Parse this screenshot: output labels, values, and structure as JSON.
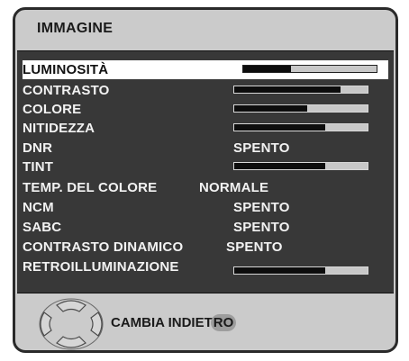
{
  "title": "IMMAGINE",
  "items": [
    {
      "label": "LUMINOSITÀ",
      "level": 0.36,
      "selected": true
    },
    {
      "label": "CONTRASTO",
      "level": 0.8
    },
    {
      "label": "COLORE",
      "level": 0.55
    },
    {
      "label": "NITIDEZZA",
      "level": 0.68
    },
    {
      "label": "DNR",
      "value": "SPENTO"
    },
    {
      "label": "TINT",
      "level": 0.68
    },
    {
      "label": "TEMP. DEL COLORE",
      "value": "NORMALE"
    },
    {
      "label": "NCM",
      "value": "SPENTO"
    },
    {
      "label": "SABC",
      "value": "SPENTO"
    },
    {
      "label": "CONTRASTO DINAMICO",
      "value": "SPENTO"
    },
    {
      "label": "RETROILLUMINAZIONE",
      "level": 0.68
    }
  ],
  "footer": {
    "text": "CAMBIA INDIET",
    "tail": "RO",
    "icon": "dpad-arrows-icon"
  }
}
